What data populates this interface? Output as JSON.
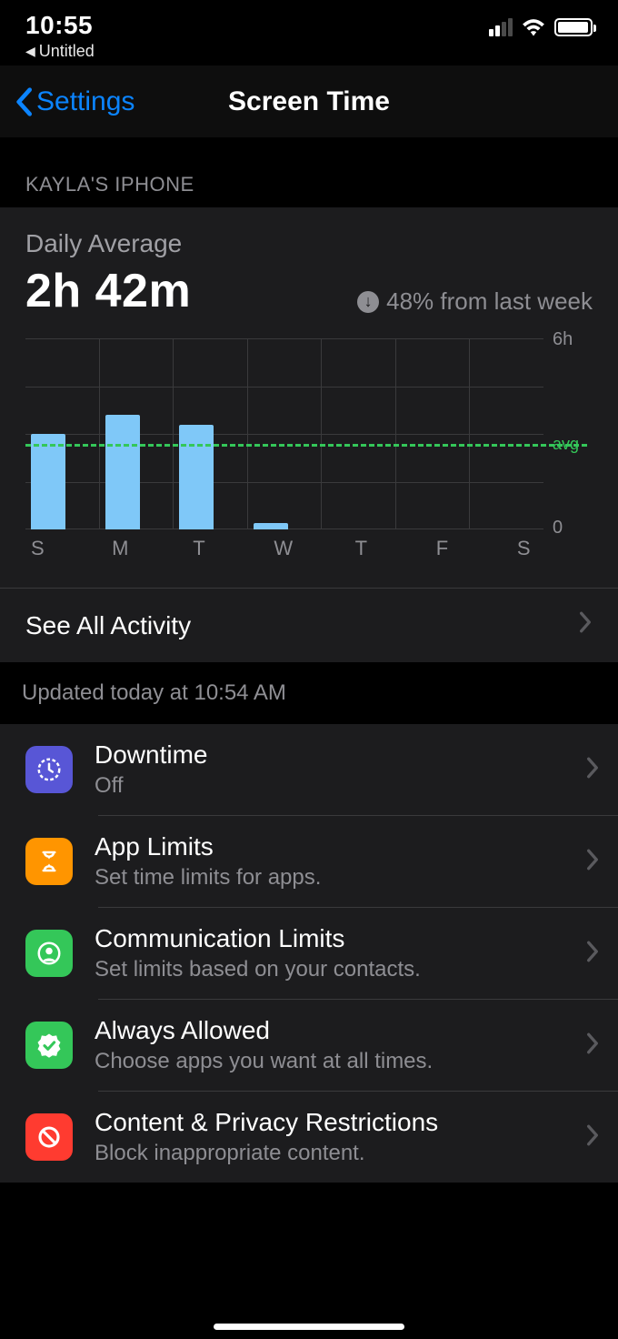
{
  "status": {
    "time": "10:55",
    "back_app": "Untitled"
  },
  "nav": {
    "back": "Settings",
    "title": "Screen Time"
  },
  "section_header": "KAYLA'S IPHONE",
  "summary": {
    "daily_avg_label": "Daily Average",
    "daily_avg_value": "2h 42m",
    "change_text": "48% from last week"
  },
  "chart_data": {
    "type": "bar",
    "categories": [
      "S",
      "M",
      "T",
      "W",
      "T",
      "F",
      "S"
    ],
    "values": [
      3.0,
      3.6,
      3.3,
      0.2,
      0,
      0,
      0
    ],
    "ylim": [
      0,
      6
    ],
    "yticks": {
      "top": "6h",
      "bottom": "0",
      "avg_label": "avg"
    },
    "avg_value": 2.7,
    "ylabel": "",
    "xlabel": "",
    "title": ""
  },
  "see_all": "See All Activity",
  "updated_text": "Updated today at 10:54 AM",
  "list": {
    "items": [
      {
        "title": "Downtime",
        "sub": "Off"
      },
      {
        "title": "App Limits",
        "sub": "Set time limits for apps."
      },
      {
        "title": "Communication Limits",
        "sub": "Set limits based on your contacts."
      },
      {
        "title": "Always Allowed",
        "sub": "Choose apps you want at all times."
      },
      {
        "title": "Content & Privacy Restrictions",
        "sub": "Block inappropriate content."
      }
    ]
  }
}
